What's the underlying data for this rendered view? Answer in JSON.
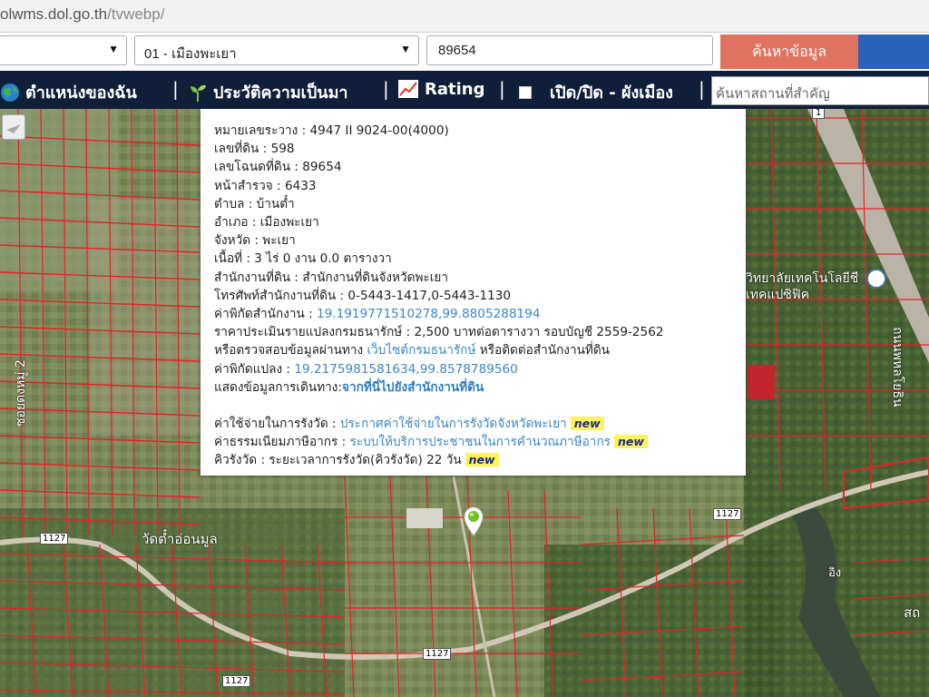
{
  "browser": {
    "url_host": "olwms.dol.go.th",
    "url_path": "/tvwebp/"
  },
  "search": {
    "province_value": "",
    "district_value": "01 - เมืองพะเยา",
    "parcel_value": "89654",
    "search_button": "ค้นหาข้อมูล"
  },
  "toolbar": {
    "my_location": "ตำแหน่งของฉัน",
    "history": "ประวัติความเป็นมา",
    "rating": "Rating",
    "toggle_zoning": "เปิด/ปิด - ผังเมือง",
    "place_search_placeholder": "ค้นหาสถานที่สำคัญ"
  },
  "popup": {
    "map_sheet": "หมายเลขระวาง : 4947 II 9024-00(4000)",
    "land_no": "เลขที่ดิน : 598",
    "deed_no": "เลขโฉนดที่ดิน : 89654",
    "survey_page": "หน้าสำรวจ : 6433",
    "subdistrict": "ตำบล : บ้านต๋ำ",
    "district": "อำเภอ : เมืองพะเยา",
    "province": "จังหวัด : พะเยา",
    "area": "เนื้อที่ : 3 ไร่ 0 งาน 0.0 ตารางวา",
    "land_office": "สำนักงานที่ดิน : สำนักงานที่ดินจังหวัดพะเยา",
    "office_phone": "โทรศัพท์สำนักงานที่ดิน : 0-5443-1417,0-5443-1130",
    "office_coord_label": "ค่าพิกัดสำนักงาน : ",
    "office_coord_value": "19.1919771510278,99.8805288194",
    "appraisal": "ราคาประเมินรายแปลงกรมธนารักษ์ : 2,500 บาทต่อตารางวา รอบบัญชี 2559-2562",
    "check_prefix": "หรือตรวจสอบข้อมูลผ่านทาง ",
    "check_link": "เว็บไซต์กรมธนารักษ์",
    "check_suffix": " หรือติดต่อสำนักงานที่ดิน",
    "parcel_coord_label": "ค่าพิกัดแปลง : ",
    "parcel_coord_value": "19.2175981581634,99.8578789560",
    "directions_label": "แสดงข้อมูลการเดินทาง:",
    "directions_link": "จากที่นี่ไปยังสำนักงานที่ดิน",
    "fee_label": "ค่าใช้จ่ายในการรังวัด : ",
    "fee_link": "ประกาศค่าใช้จ่ายในการรังวัดจังหวัดพะเยา",
    "tax_label": "ค่าธรรมเนียมภาษีอากร : ",
    "tax_link": "ระบบให้บริการประชาชนในการคำนวณภาษีอากร",
    "queue": "คิวรังวัด : ระยะเวลาการรังวัด(คิวรังวัด) 22 วัน",
    "new_badge": "new"
  },
  "map": {
    "road_label_1127_a": "1127",
    "road_label_1127_b": "1127",
    "road_label_1127_c": "1127",
    "road_label_1127_d": "1127",
    "road_label_1": "1",
    "temple_label": "วัดต๋ำอ่อนมูล",
    "road_vertical_label": "ซอยดงหมู่ 2",
    "school_label": "วิทยาลัยเทคโนโลยีชีเทคแปซิฟิค",
    "highway_label": "ถนนพหลโยธิน",
    "river_label": "อิง",
    "edge_label": "สถ"
  },
  "colors": {
    "toolbar_bg": "#0f1f3a",
    "search_button": "#e0735f",
    "parcel_line": "#e8202a",
    "link": "#3b86c9",
    "new_badge": "#fff25a"
  }
}
